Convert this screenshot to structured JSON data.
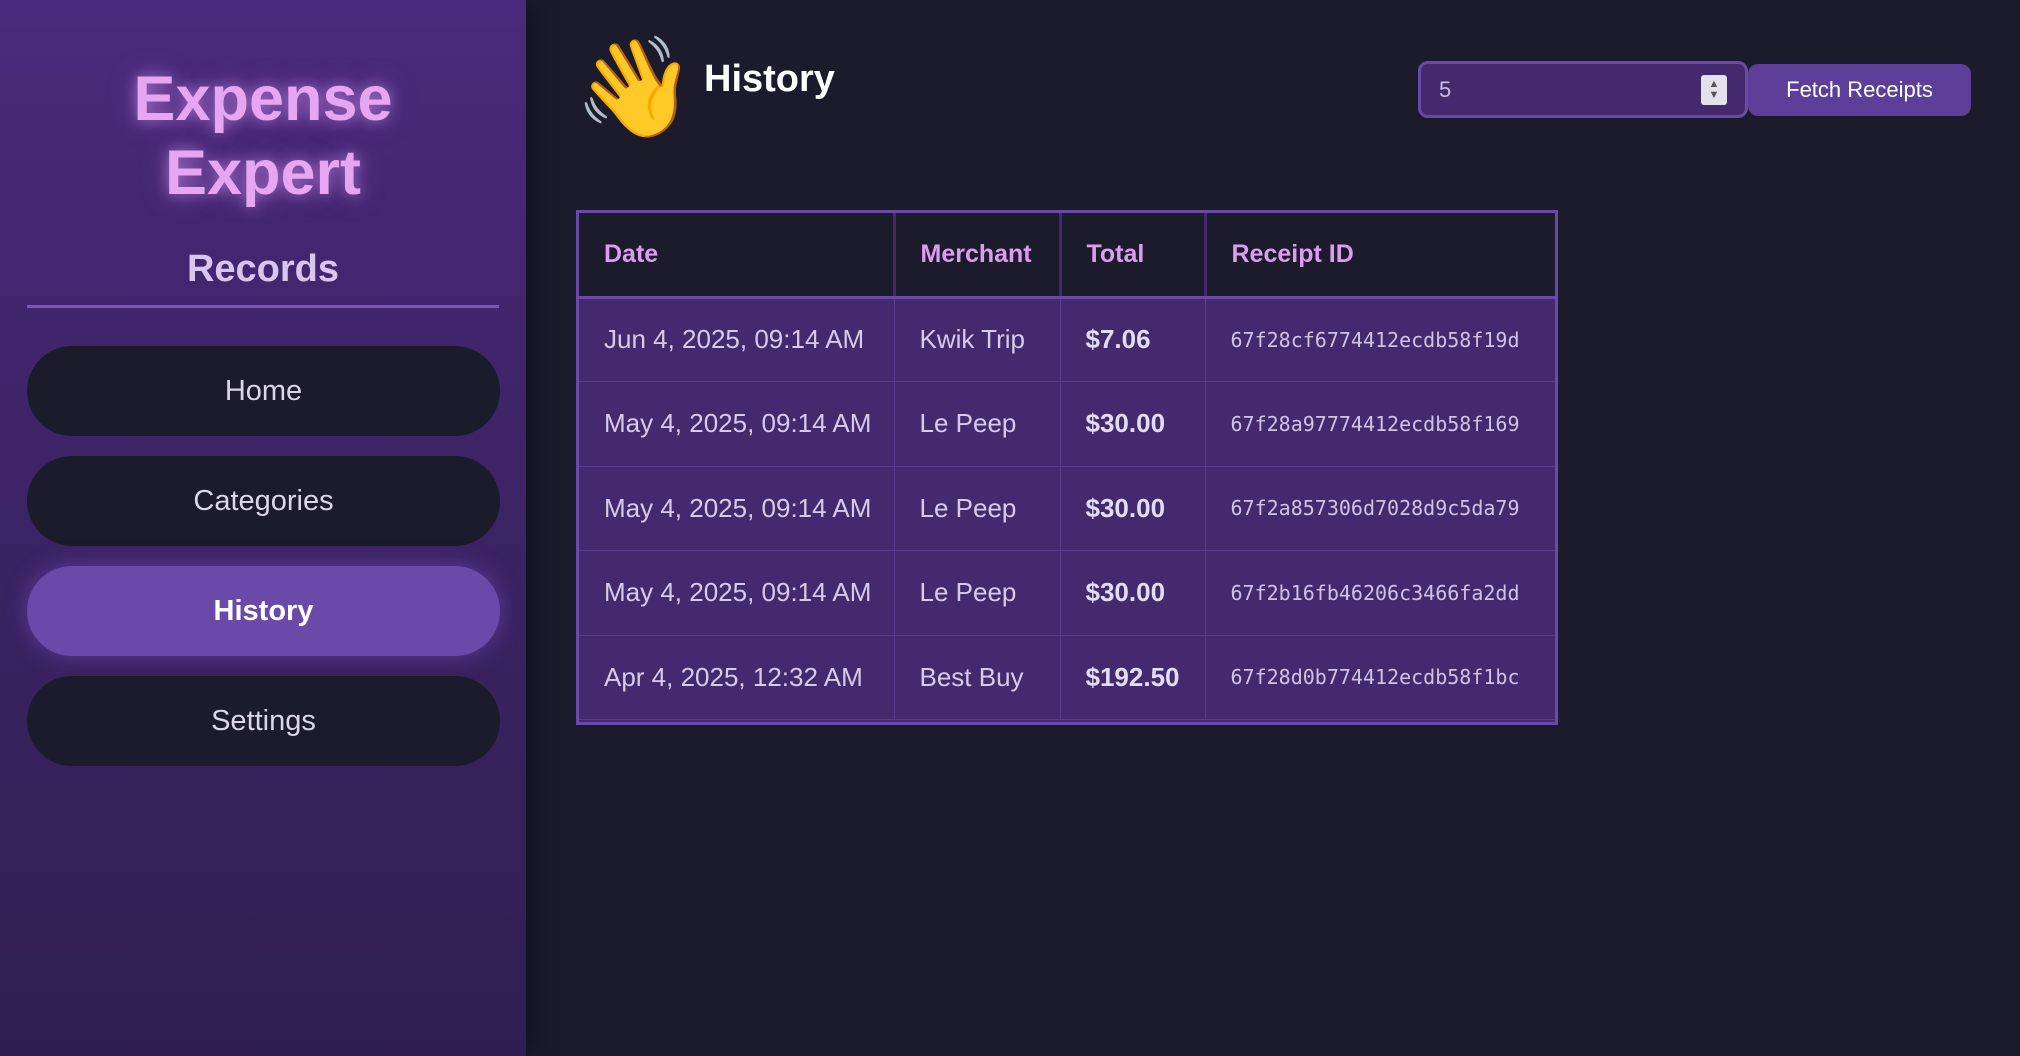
{
  "sidebar": {
    "logo_line1": "Expense",
    "logo_line2": "Expert",
    "section_title": "Records",
    "items": [
      {
        "label": "Home"
      },
      {
        "label": "Categories"
      },
      {
        "label": "History"
      },
      {
        "label": "Settings"
      }
    ],
    "active_item": "History"
  },
  "header": {
    "icon": "waving-hand-icon",
    "icon_glyph": "👋",
    "title": "History",
    "count_value": "5",
    "fetch_label": "Fetch Receipts"
  },
  "table": {
    "headers": [
      "Date",
      "Merchant",
      "Total",
      "Receipt ID"
    ],
    "rows": [
      {
        "date": "Jun 4, 2025, 09:14 AM",
        "merchant": "Kwik Trip",
        "total": "$7.06",
        "receipt_id": "67f28cf6774412ecdb58f19d"
      },
      {
        "date": "May 4, 2025, 09:14 AM",
        "merchant": "Le Peep",
        "total": "$30.00",
        "receipt_id": "67f28a97774412ecdb58f169"
      },
      {
        "date": "May 4, 2025, 09:14 AM",
        "merchant": "Le Peep",
        "total": "$30.00",
        "receipt_id": "67f2a857306d7028d9c5da79"
      },
      {
        "date": "May 4, 2025, 09:14 AM",
        "merchant": "Le Peep",
        "total": "$30.00",
        "receipt_id": "67f2b16fb46206c3466fa2dd"
      },
      {
        "date": "Apr 4, 2025, 12:32 AM",
        "merchant": "Best Buy",
        "total": "$192.50",
        "receipt_id": "67f28d0b774412ecdb58f1bc"
      }
    ]
  },
  "colors": {
    "background": "#1b1b2b",
    "sidebar": "#4a2a7c",
    "accent": "#6a4aa8",
    "logo": "#e7a6f4",
    "table_header_text": "#de9cf0"
  }
}
